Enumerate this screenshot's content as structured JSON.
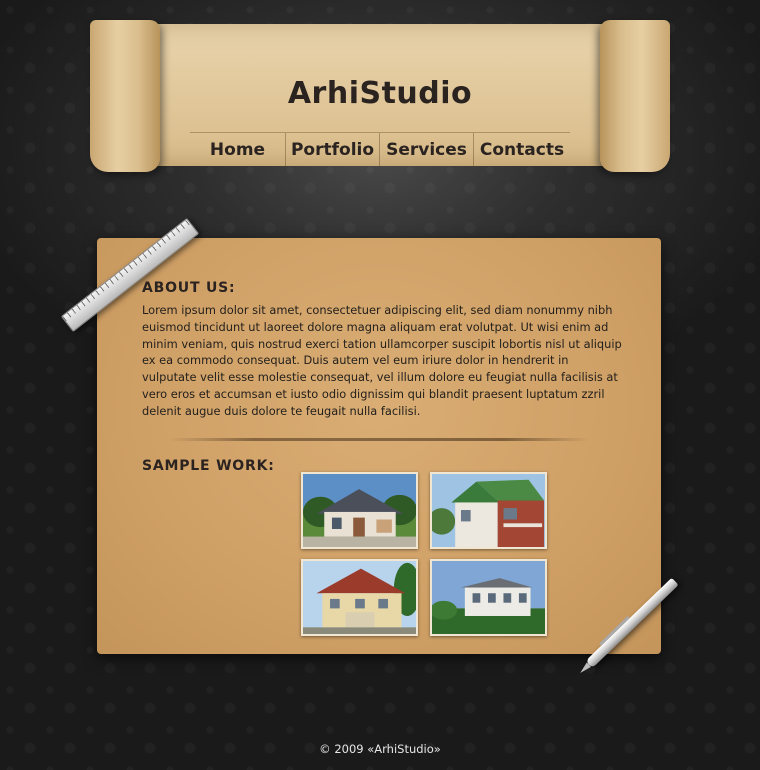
{
  "header": {
    "title": "ArhiStudio",
    "nav": [
      "Home",
      "Portfolio",
      "Services",
      "Contacts"
    ]
  },
  "about": {
    "heading": "ABOUT US:",
    "text": "Lorem ipsum dolor sit amet, consectetuer adipiscing elit, sed diam nonummy nibh euismod tincidunt ut laoreet dolore magna aliquam erat volutpat. Ut wisi enim ad minim veniam, quis nostrud exerci tation ullamcorper suscipit lobortis nisl ut aliquip ex ea commodo consequat. Duis autem vel eum iriure dolor in hendrerit in vulputate velit esse molestie consequat, vel illum dolore eu feugiat nulla facilisis at vero eros et accumsan et iusto odio dignissim qui blandit praesent luptatum zzril delenit augue duis dolore te feugait nulla facilisi."
  },
  "sample_work": {
    "heading": "SAMPLE WORK:"
  },
  "footer": {
    "text": "© 2009 «ArhiStudio»"
  },
  "colors": {
    "background": "#2b2b2b",
    "parchment": "#cfa066",
    "scroll": "#e2c99d",
    "text_dark": "#2a2320",
    "footer_text": "#e6e6e6"
  },
  "icons": [
    "ruler-icon",
    "pen-icon"
  ]
}
